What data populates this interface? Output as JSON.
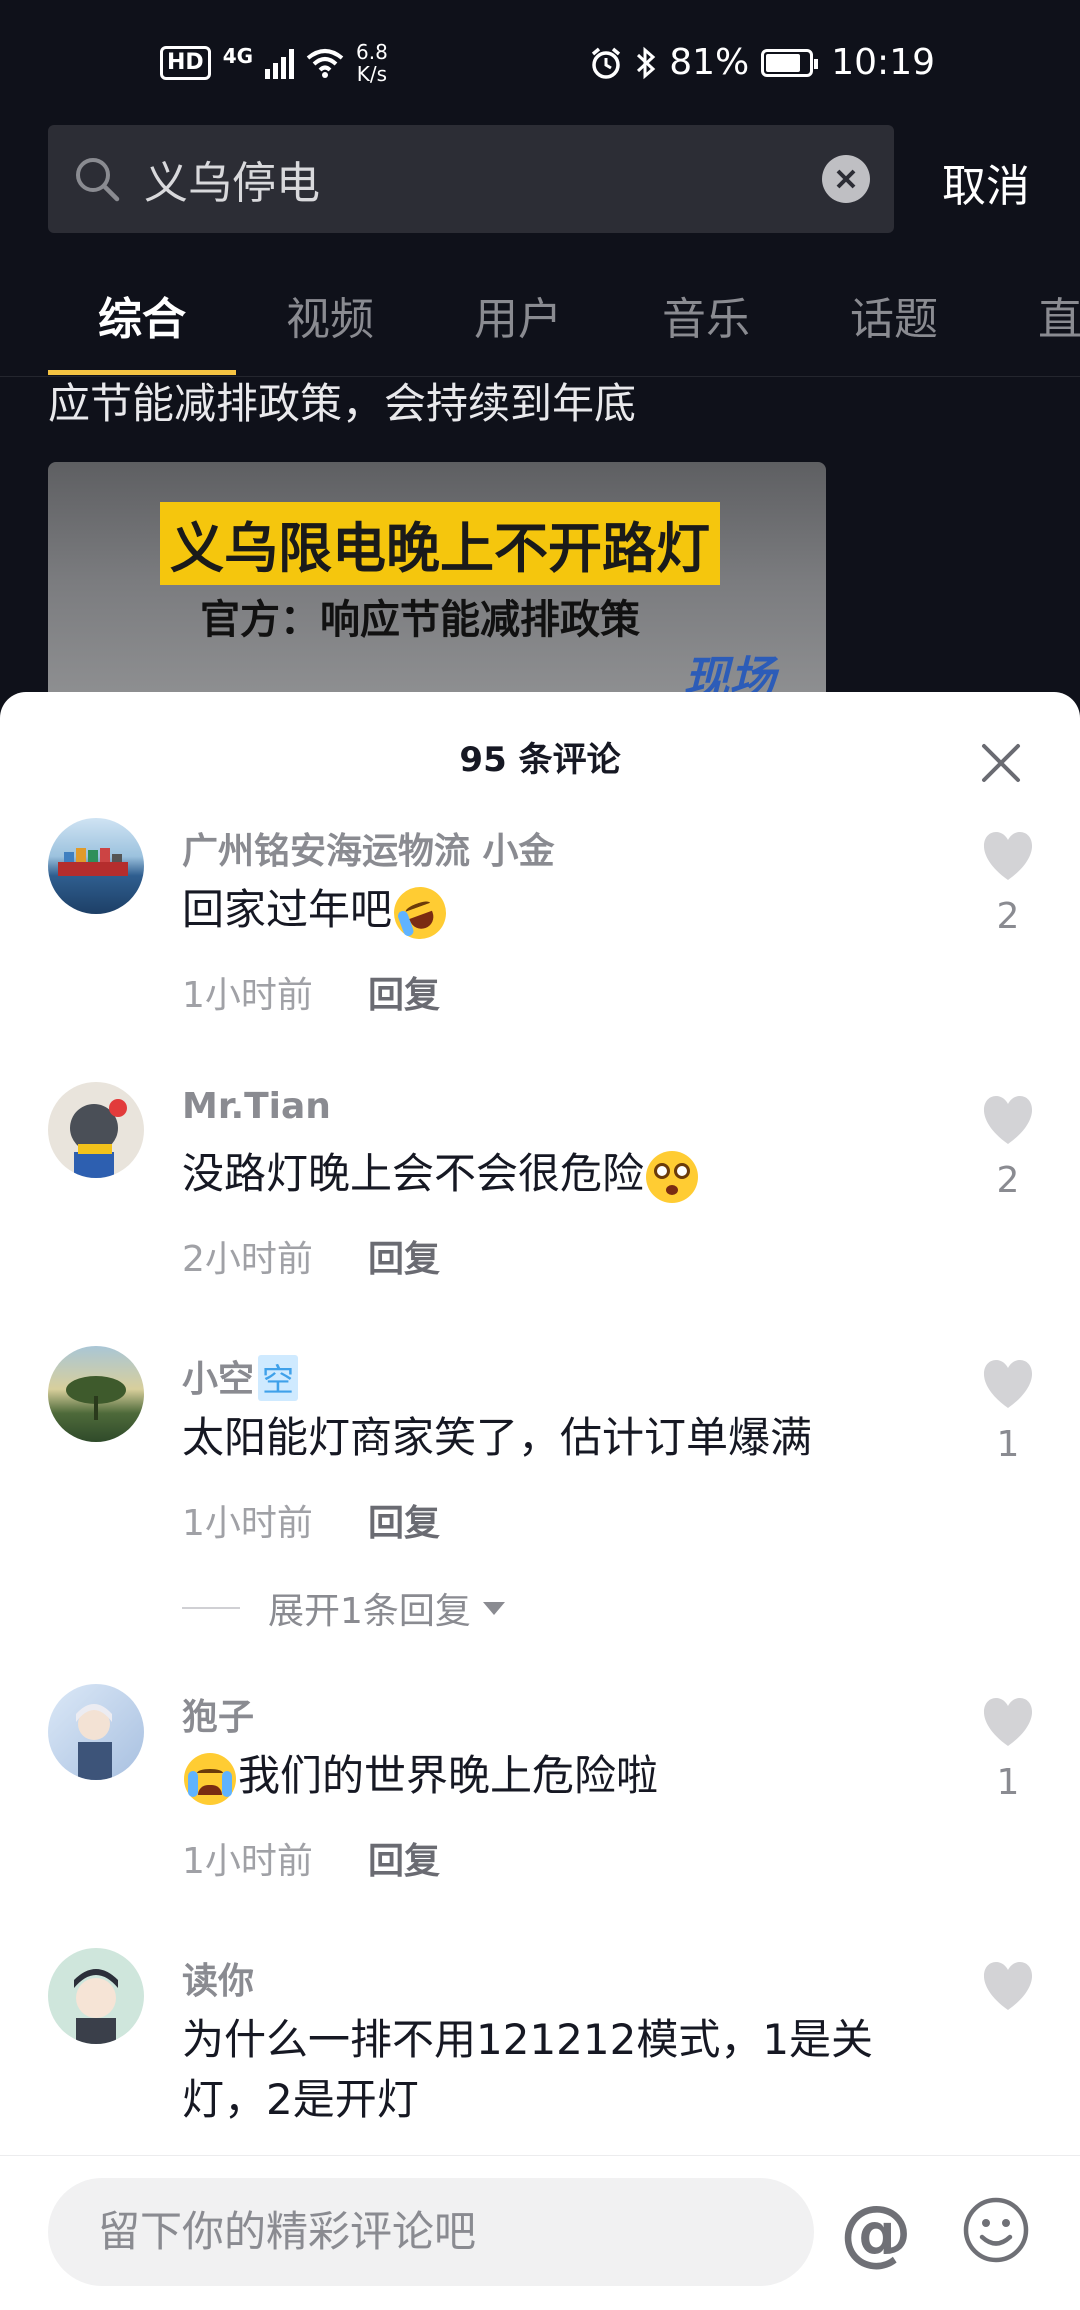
{
  "status_bar": {
    "hd": "HD",
    "network": "4G",
    "speed_value": "6.8",
    "speed_unit": "K/s",
    "battery": "81%",
    "time": "10:19"
  },
  "search": {
    "query": "义乌停电",
    "cancel_label": "取消"
  },
  "tabs": [
    {
      "label": "综合",
      "active": true
    },
    {
      "label": "视频",
      "active": false
    },
    {
      "label": "用户",
      "active": false
    },
    {
      "label": "音乐",
      "active": false
    },
    {
      "label": "话题",
      "active": false
    },
    {
      "label": "直播",
      "active": false
    }
  ],
  "background": {
    "result_text": "应节能减排政策，会持续到年底",
    "video_title": "义乌限电晚上不开路灯",
    "video_subtitle": "官方：响应节能减排政策",
    "video_logo": "现场"
  },
  "comments_sheet": {
    "title": "95 条评论",
    "reply_label": "回复",
    "comments": [
      {
        "user": "广州铭安海运物流 小金",
        "tag": "",
        "text": "回家过年吧",
        "emoji": "rofl",
        "time": "1小时前",
        "likes": "2"
      },
      {
        "user": "Mr.Tian",
        "tag": "",
        "text": "没路灯晚上会不会很危险",
        "emoji": "flushed",
        "time": "2小时前",
        "likes": "2"
      },
      {
        "user": "小空",
        "tag": "空",
        "text": "太阳能灯商家笑了，估计订单爆满",
        "emoji": "",
        "time": "1小时前",
        "likes": "1"
      },
      {
        "user": "狍子",
        "tag": "",
        "text": "我们的世界晚上危险啦",
        "emoji": "crying",
        "time": "1小时前",
        "likes": "1"
      },
      {
        "user": "读你",
        "tag": "",
        "text": "为什么一排不用121212模式，1是关灯，2是开灯",
        "emoji": "",
        "time": "",
        "likes": ""
      }
    ],
    "expand_replies": "展开1条回复"
  },
  "input_bar": {
    "placeholder": "留下你的精彩评论吧",
    "at_symbol": "@"
  },
  "colors": {
    "background": "#0f111a",
    "accent_tab_underline": "#f5c342",
    "sheet": "#ffffff",
    "muted_text": "#8a8b91"
  }
}
